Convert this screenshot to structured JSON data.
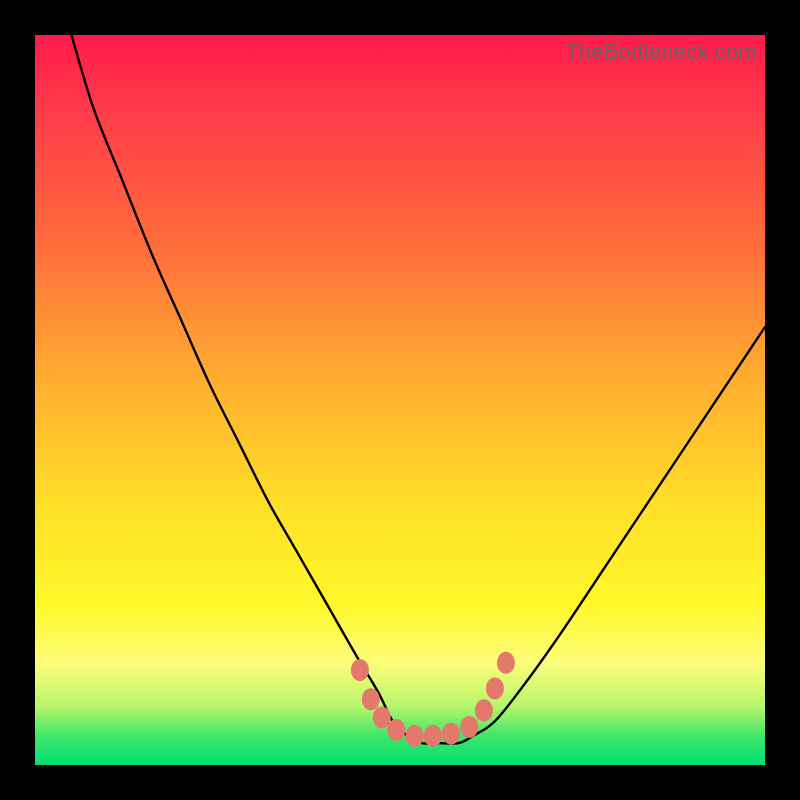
{
  "watermark": "TheBottleneck.com",
  "colors": {
    "frame": "#000000",
    "curve": "#000000",
    "marker": "#e5786d",
    "gradient_top": "#ff1a4a",
    "gradient_bottom": "#00e070"
  },
  "chart_data": {
    "type": "line",
    "title": "",
    "xlabel": "",
    "ylabel": "",
    "xlim": [
      0,
      100
    ],
    "ylim": [
      0,
      100
    ],
    "x": [
      5,
      8,
      12,
      16,
      20,
      24,
      28,
      32,
      36,
      40,
      44,
      47,
      49,
      51,
      53,
      55,
      58,
      60,
      63,
      67,
      72,
      78,
      84,
      90,
      96,
      100
    ],
    "y": [
      100,
      90,
      80,
      70,
      61,
      52,
      44,
      36,
      29,
      22,
      15,
      10,
      6,
      4,
      3,
      3,
      3,
      4,
      6,
      11,
      18,
      27,
      36,
      45,
      54,
      60
    ],
    "markers_x": [
      44.5,
      46,
      47.5,
      49.5,
      52,
      54.5,
      57,
      59.5,
      61.5,
      63,
      64.5
    ],
    "markers_y": [
      13,
      9,
      6.5,
      4.8,
      4,
      4,
      4.3,
      5.2,
      7.5,
      10.5,
      14
    ]
  }
}
